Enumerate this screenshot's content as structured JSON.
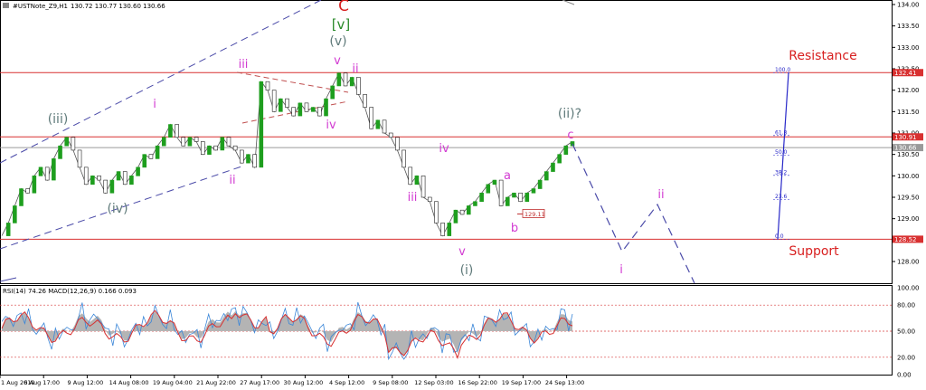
{
  "header": {
    "symbol_label": "#USTNote_Z9,H1",
    "ohlc": "130.72 130.77 130.60 130.66"
  },
  "indicator": {
    "label": "RSI(14) 74.26 MACD(12,26,9) 0.166 0.093",
    "levels": [
      "100.00",
      "80.00",
      "50.00",
      "20.00",
      "0.00"
    ]
  },
  "colors": {
    "price": "#1e9e1e",
    "wave_count_major": "#5f7a7a",
    "wave_count_minor": "#d23bd2",
    "wave_c_red": "#d82020",
    "bracket_v_green": "#2a8a2a",
    "hline": "#d83030",
    "fib": "#3a3aa8",
    "projection": "#4a4aa8"
  },
  "chart_data": [
    {
      "type": "line",
      "title": "",
      "y_ticks": [
        "134.00",
        "133.50",
        "133.00",
        "132.50",
        "132.00",
        "131.50",
        "131.00",
        "130.50",
        "130.00",
        "129.50",
        "129.00",
        "128.50",
        "128.00"
      ],
      "ylim": [
        127.6,
        134.1
      ],
      "x_ticks": [
        "1 Aug 2019",
        "6 Aug 17:00",
        "9 Aug 12:00",
        "14 Aug 08:00",
        "19 Aug 04:00",
        "21 Aug 22:00",
        "27 Aug 17:00",
        "30 Aug 12:00",
        "4 Sep 12:00",
        "9 Sep 08:00",
        "12 Sep 03:00",
        "16 Sep 22:00",
        "19 Sep 17:00",
        "24 Sep 13:00"
      ],
      "series": [
        {
          "values": [
            128.6,
            128.9,
            129.3,
            129.7,
            129.6,
            130.0,
            130.2,
            129.9,
            130.4,
            130.7,
            130.9,
            130.6,
            130.2,
            129.8,
            130.0,
            129.9,
            129.6,
            129.9,
            130.1,
            129.8,
            130.0,
            130.2,
            130.5,
            130.4,
            130.7,
            130.9,
            131.2,
            130.9,
            130.7,
            130.9,
            130.8,
            130.5,
            130.7,
            130.6,
            130.9,
            130.7,
            130.6,
            130.3,
            130.5,
            130.2,
            132.2,
            132.0,
            131.5,
            131.8,
            131.6,
            131.4,
            131.7,
            131.5,
            131.6,
            131.4,
            131.8,
            132.1,
            132.4,
            132.1,
            132.3,
            131.9,
            131.6,
            131.1,
            131.3,
            131.0,
            130.9,
            130.6,
            130.2,
            129.8,
            130.0,
            129.5,
            129.4,
            128.9,
            128.6,
            128.9,
            129.2,
            129.1,
            129.3,
            129.4,
            129.6,
            129.8,
            129.9,
            129.3,
            129.5,
            129.6,
            129.4,
            129.6,
            129.7,
            129.9,
            130.1,
            130.3,
            130.5,
            130.7,
            130.8
          ]
        }
      ],
      "horizontal_lines": [
        {
          "value": 132.41,
          "label": "132.41"
        },
        {
          "value": 130.91,
          "label": "130.91"
        },
        {
          "value": 130.66,
          "label": "130.66"
        },
        {
          "value": 128.52,
          "label": "128.52"
        }
      ],
      "annotations": {
        "resistance": "Resistance",
        "support": "Support",
        "wave_c": "C",
        "wave_v_bracket": "[v]",
        "wave_v_paren": "(v)",
        "wave_iii_paren": "(iii)",
        "wave_iv_paren": "(iv)",
        "wave_i_paren": "(i)",
        "wave_ii_paren_q": "(ii)?",
        "minor_i": "i",
        "minor_ii": "ii",
        "minor_iii": "iii",
        "minor_iv": "iv",
        "minor_v": "v",
        "minor_a": "a",
        "minor_b": "b",
        "minor_c": "c",
        "proj_i": "i",
        "proj_ii": "ii",
        "low_label": "129.11"
      },
      "fibonacci": [
        {
          "ratio": "100.0",
          "value": 132.41
        },
        {
          "ratio": "61.8",
          "value": 130.94
        },
        {
          "ratio": "50.0",
          "value": 130.48
        },
        {
          "ratio": "38.2",
          "value": 130.01
        },
        {
          "ratio": "23.6",
          "value": 129.45
        },
        {
          "ratio": "0.0",
          "value": 128.52
        }
      ]
    }
  ]
}
